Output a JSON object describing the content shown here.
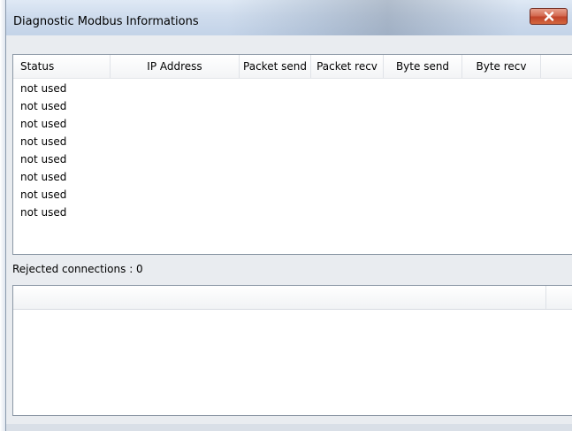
{
  "window": {
    "title": "Diagnostic Modbus Informations",
    "close_icon": "close-icon"
  },
  "connections_table": {
    "columns": [
      "Status",
      "IP Address",
      "Packet send",
      "Packet recv",
      "Byte send",
      "Byte recv"
    ],
    "rows": [
      {
        "status": "not used"
      },
      {
        "status": "not used"
      },
      {
        "status": "not used"
      },
      {
        "status": "not used"
      },
      {
        "status": "not used"
      },
      {
        "status": "not used"
      },
      {
        "status": "not used"
      },
      {
        "status": "not used"
      }
    ]
  },
  "rejected": {
    "label": "Rejected connections : 0"
  },
  "rejected_table": {
    "columns": [
      ""
    ],
    "rows": []
  },
  "colors": {
    "titlebar": "#cfdced",
    "close_button": "#c0432a",
    "client_bg": "#e9ecf0",
    "border": "#8b97a5"
  }
}
